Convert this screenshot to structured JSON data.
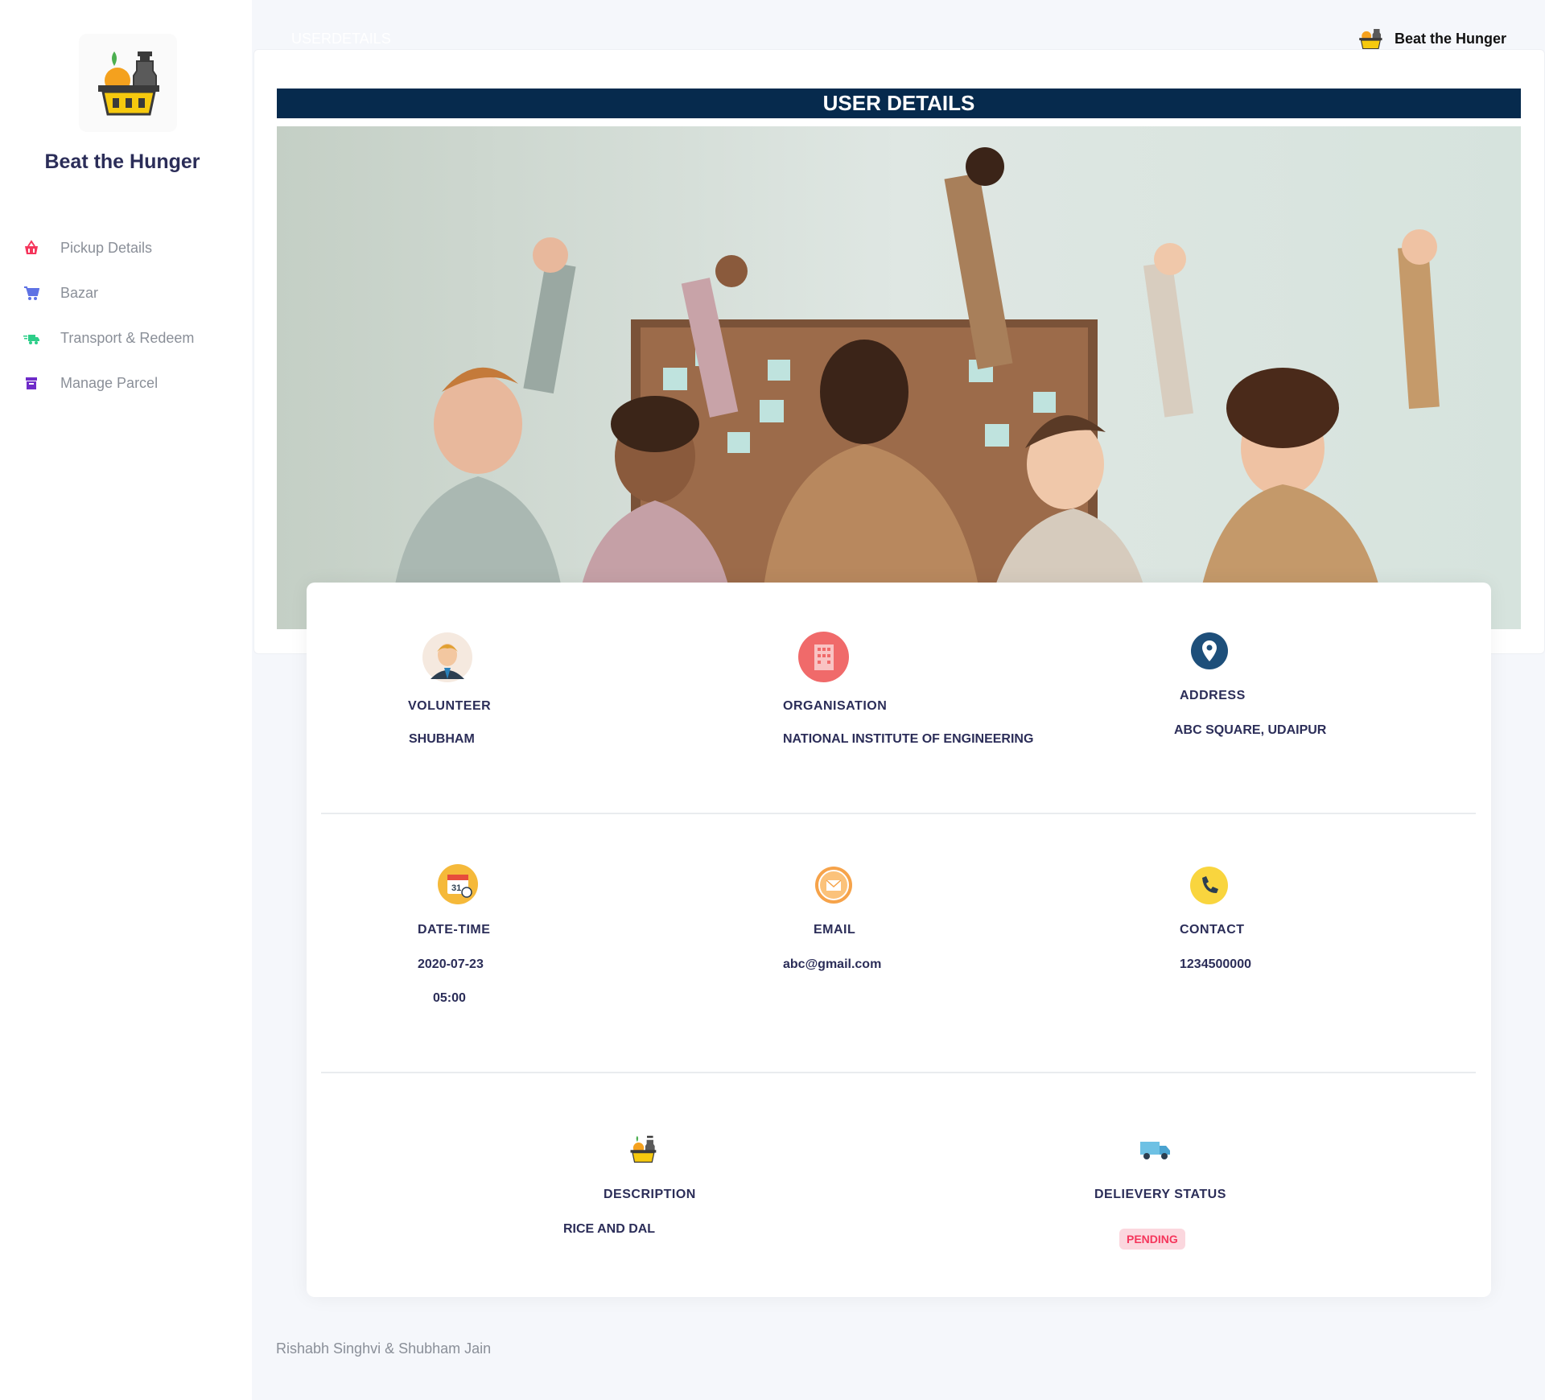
{
  "app": {
    "name": "Beat the Hunger"
  },
  "sidebar": {
    "items": [
      {
        "label": "Pickup Details",
        "icon": "basket-icon",
        "color": "#f5365c"
      },
      {
        "label": "Bazar",
        "icon": "cart-icon",
        "color": "#5e72e4"
      },
      {
        "label": "Transport & Redeem",
        "icon": "delivery-icon",
        "color": "#2dce89"
      },
      {
        "label": "Manage Parcel",
        "icon": "parcel-icon",
        "color": "#6f2cc9"
      }
    ]
  },
  "topbar": {
    "breadcrumb": "USERDETAILS",
    "user_name": "Beat the Hunger"
  },
  "page": {
    "title": "USER DETAILS"
  },
  "details": {
    "volunteer": {
      "label": "VOLUNTEER",
      "value": "SHUBHAM"
    },
    "organisation": {
      "label": "ORGANISATION",
      "value": "NATIONAL INSTITUTE OF ENGINEERING"
    },
    "address": {
      "label": "ADDRESS",
      "value": "ABC SQUARE, UDAIPUR"
    },
    "datetime": {
      "label": "DATE-TIME",
      "date": "2020-07-23",
      "time": "05:00"
    },
    "email": {
      "label": "EMAIL",
      "value": "abc@gmail.com"
    },
    "contact": {
      "label": "CONTACT",
      "value": "1234500000"
    },
    "description": {
      "label": "DESCRIPTION",
      "value": "RICE AND DAL"
    },
    "delivery_status": {
      "label": "DELIEVERY STATUS",
      "value": "PENDING"
    }
  },
  "footer": {
    "credits": "Rishabh Singhvi & Shubham Jain"
  },
  "colors": {
    "banner": "#062a4d",
    "pending_bg": "#fbd7de",
    "pending_text": "#f5365c"
  }
}
